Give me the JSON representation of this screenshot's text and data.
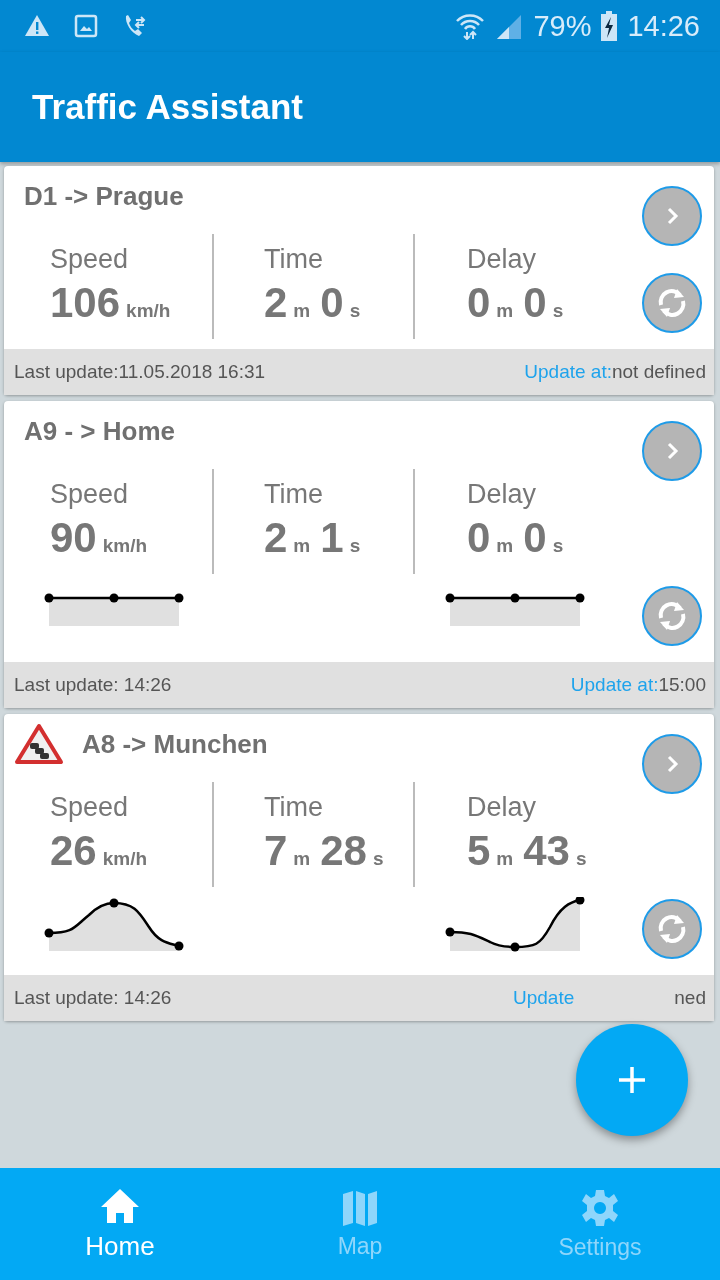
{
  "status_bar": {
    "battery": "79%",
    "time": "14:26"
  },
  "app_bar": {
    "title": "Traffic Assistant"
  },
  "routes": [
    {
      "title": "D1 -> Prague",
      "alert": false,
      "metrics": [
        {
          "label": "Speed",
          "parts": [
            {
              "value": "106",
              "unit": "km/h"
            }
          ]
        },
        {
          "label": "Time",
          "parts": [
            {
              "value": "2",
              "unit": "m"
            },
            {
              "value": "0",
              "unit": "s"
            }
          ]
        },
        {
          "label": "Delay",
          "parts": [
            {
              "value": "0",
              "unit": "m"
            },
            {
              "value": "0",
              "unit": "s"
            }
          ]
        }
      ],
      "footer": {
        "last_update": "Last update:11.05.2018 16:31",
        "update_label": "Update at:",
        "update_value": "not defined",
        "covered": false
      }
    },
    {
      "title": "A9 - > Home",
      "alert": false,
      "metrics": [
        {
          "label": "Speed",
          "parts": [
            {
              "value": "90",
              "unit": "km/h"
            }
          ],
          "sparkline": {
            "kind": "flat"
          }
        },
        {
          "label": "Time",
          "parts": [
            {
              "value": "2",
              "unit": "m"
            },
            {
              "value": "1",
              "unit": "s"
            }
          ]
        },
        {
          "label": "Delay",
          "parts": [
            {
              "value": "0",
              "unit": "m"
            },
            {
              "value": "0",
              "unit": "s"
            }
          ],
          "sparkline": {
            "kind": "flat"
          }
        }
      ],
      "footer": {
        "last_update": "Last update: 14:26",
        "update_label": "Update at:",
        "update_value": "15:00",
        "covered": false
      }
    },
    {
      "title": "A8 -> Munchen",
      "alert": true,
      "metrics": [
        {
          "label": "Speed",
          "parts": [
            {
              "value": "26",
              "unit": "km/h"
            }
          ],
          "sparkline": {
            "kind": "hump"
          }
        },
        {
          "label": "Time",
          "parts": [
            {
              "value": "7",
              "unit": "m"
            },
            {
              "value": "28",
              "unit": "s"
            }
          ]
        },
        {
          "label": "Delay",
          "parts": [
            {
              "value": "5",
              "unit": "m"
            },
            {
              "value": "43",
              "unit": "s"
            }
          ],
          "sparkline": {
            "kind": "dip"
          }
        }
      ],
      "footer": {
        "last_update": "Last update: 14:26",
        "update_label": "Update",
        "update_value": "ned",
        "covered": true
      }
    }
  ],
  "nav": [
    {
      "label": "Home",
      "kind": "home",
      "selected": true
    },
    {
      "label": "Map",
      "kind": "map",
      "selected": false
    },
    {
      "label": "Settings",
      "kind": "settings",
      "selected": false
    }
  ]
}
